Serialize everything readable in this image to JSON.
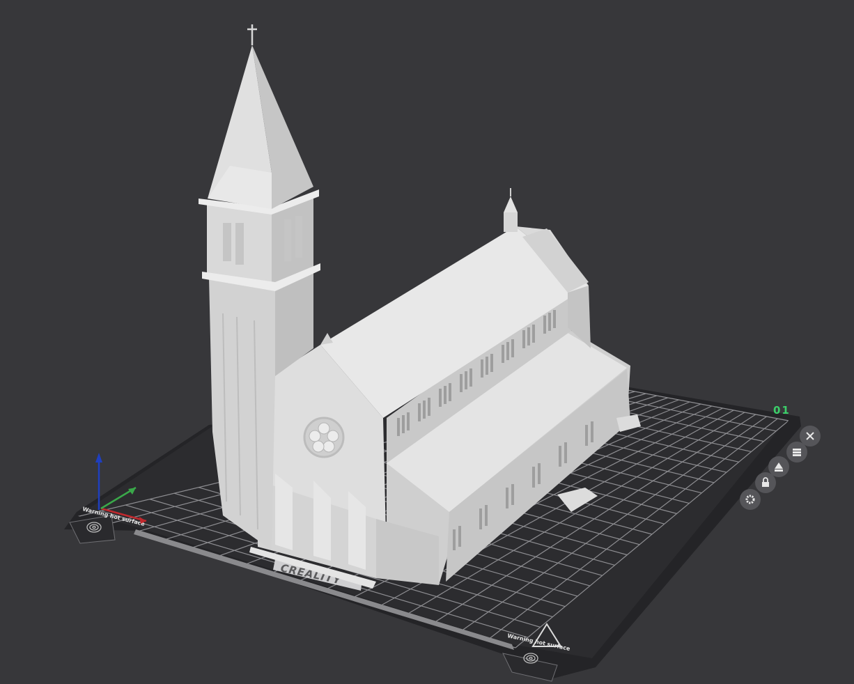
{
  "plate": {
    "label": "01",
    "label_color": "#3ccf6a",
    "brand": "CREALITY",
    "warning_front": "Warning hot surface",
    "warning_left": "Warning hot surface"
  },
  "toolbar": {
    "buttons": [
      {
        "name": "close-plate-button",
        "icon": "close-icon"
      },
      {
        "name": "arrange-button",
        "icon": "arrange-icon"
      },
      {
        "name": "auto-orient-button",
        "icon": "orient-icon"
      },
      {
        "name": "lock-plate-button",
        "icon": "lock-icon"
      },
      {
        "name": "plate-settings-button",
        "icon": "gear-icon"
      }
    ]
  },
  "colors": {
    "background": "#37373a",
    "bed": "#2b2b2e",
    "grid": "#9a9a9e",
    "model": "#d9d9d9",
    "axis_x": "#c0282d",
    "axis_y": "#3aa84a",
    "axis_z": "#1f3fbf"
  },
  "model": {
    "name": "church"
  }
}
